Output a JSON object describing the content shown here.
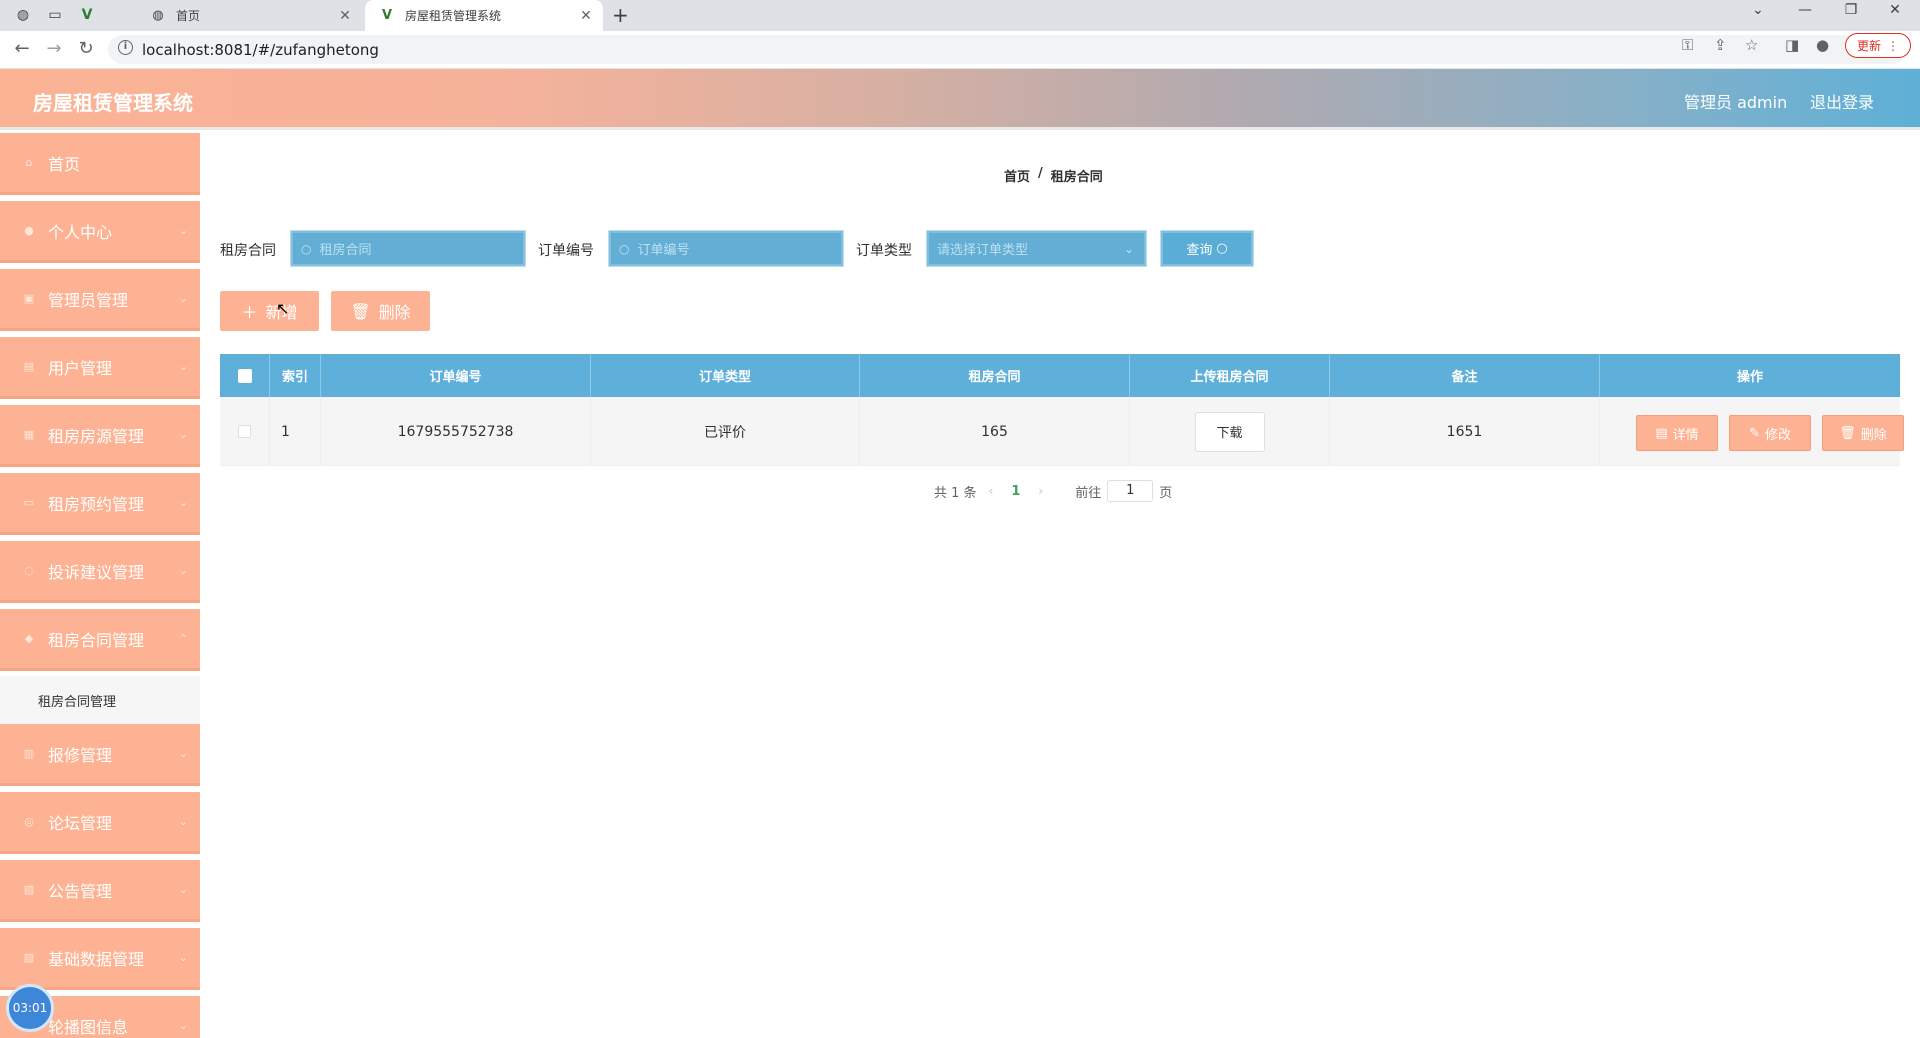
{
  "browser": {
    "inactive_tab_title": "首页",
    "active_tab_title": "房屋租赁管理系统",
    "url": "localhost:8081/#/zufanghetong",
    "update_label": "更新"
  },
  "header": {
    "app_title": "房屋租赁管理系统",
    "admin_label": "管理员 admin",
    "logout_label": "退出登录"
  },
  "sidebar": {
    "items": [
      {
        "label": "首页"
      },
      {
        "label": "个人中心"
      },
      {
        "label": "管理员管理"
      },
      {
        "label": "用户管理"
      },
      {
        "label": "租房房源管理"
      },
      {
        "label": "租房预约管理"
      },
      {
        "label": "投诉建议管理"
      },
      {
        "label": "租房合同管理"
      },
      {
        "label": "报修管理"
      },
      {
        "label": "论坛管理"
      },
      {
        "label": "公告管理"
      },
      {
        "label": "基础数据管理"
      },
      {
        "label": "轮播图信息"
      }
    ],
    "submenu_label": "租房合同管理"
  },
  "recording_time": "03:01",
  "breadcrumb": {
    "home": "首页",
    "separator": "/",
    "current": "租房合同"
  },
  "filters": {
    "contract_label": "租房合同",
    "contract_placeholder": "租房合同",
    "order_no_label": "订单编号",
    "order_no_placeholder": "订单编号",
    "order_type_label": "订单类型",
    "order_type_placeholder": "请选择订单类型",
    "query_label": "查询"
  },
  "actions": {
    "add_label": "新增",
    "delete_label": "删除"
  },
  "table": {
    "columns": [
      "索引",
      "订单编号",
      "订单类型",
      "租房合同",
      "上传租房合同",
      "备注",
      "操作"
    ],
    "rows": [
      {
        "index": "1",
        "order_no": "1679555752738",
        "order_type": "已评价",
        "contract": "165",
        "upload_label": "下载",
        "remark": "1651",
        "detail_label": "详情",
        "edit_label": "修改",
        "delete_label": "删除"
      }
    ]
  },
  "pagination": {
    "total_label": "共 1 条",
    "current_page": "1",
    "goto_label": "前往",
    "goto_value": "1",
    "page_suffix": "页"
  },
  "colors": {
    "sidebar_bg": "#fdb393",
    "table_header_bg": "#5eafd9",
    "accent_blue": "#62aed4"
  }
}
